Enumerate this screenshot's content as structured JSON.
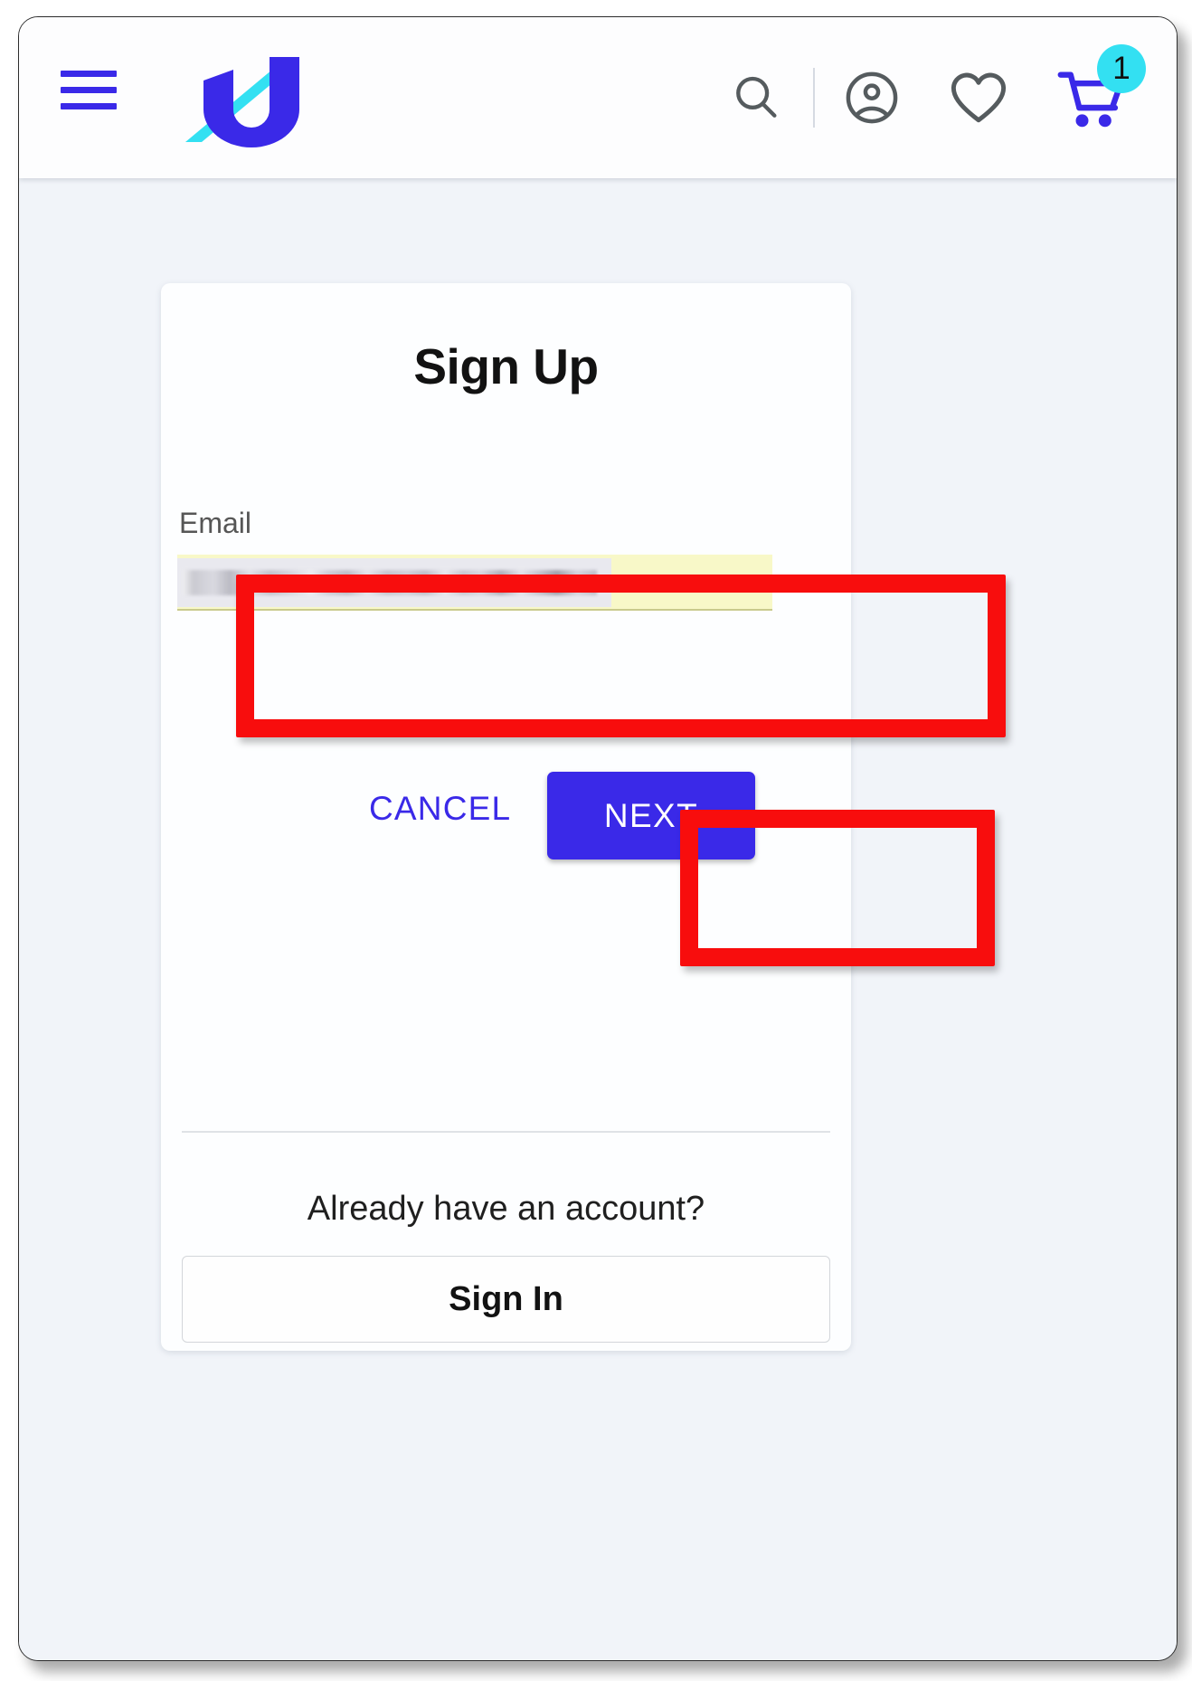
{
  "header": {
    "menu_icon": "hamburger-menu-icon",
    "logo_alt": "U",
    "icons": [
      {
        "name": "search-icon",
        "label": "Search"
      },
      {
        "name": "account-icon",
        "label": "Account"
      },
      {
        "name": "wishlist-heart-icon",
        "label": "Wishlist"
      },
      {
        "name": "shopping-cart-icon",
        "label": "Cart"
      }
    ],
    "cart_badge_count": "1"
  },
  "card": {
    "title": "Sign Up",
    "email": {
      "label": "Email",
      "value": "",
      "placeholder": "",
      "autofilled": true
    },
    "cancel_label": "CANCEL",
    "next_label": "NEXT",
    "already_have_account": "Already have an account?",
    "sign_in_label": "Sign In"
  },
  "annotations": {
    "highlight_color": "#f80d0d",
    "boxes": [
      {
        "name": "email-field-highlight",
        "target": "email-input"
      },
      {
        "name": "next-button-highlight",
        "target": "next-button"
      }
    ]
  },
  "colors": {
    "brand_blue": "#3a29e8",
    "brand_cyan": "#33e0f2",
    "page_background": "#f1f4f9",
    "card_background": "#fdfeff",
    "autofill_yellow": "#f8f8c8",
    "annotation_red": "#f80d0d"
  }
}
